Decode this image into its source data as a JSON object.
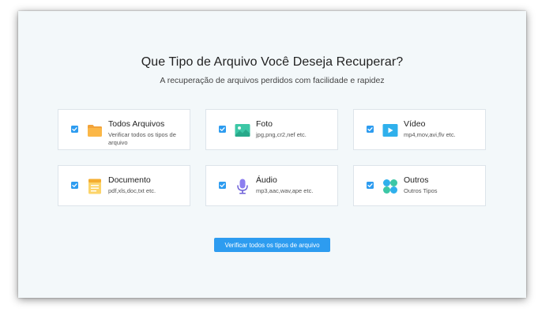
{
  "header": {
    "title": "Que Tipo de Arquivo Você Deseja Recuperar?",
    "subtitle": "A recuperação de arquivos perdidos com facilidade e rapidez"
  },
  "file_types": [
    {
      "label": "Todos Arquivos",
      "description": "Verificar todos os tipos de arquivo",
      "checked": true,
      "icon": "folder-icon"
    },
    {
      "label": "Foto",
      "description": "jpg,png,cr2,nef etc.",
      "checked": true,
      "icon": "image-icon"
    },
    {
      "label": "Vídeo",
      "description": "mp4,mov,avi,flv etc.",
      "checked": true,
      "icon": "video-play-icon"
    },
    {
      "label": "Documento",
      "description": "pdf,xls,doc,txt etc.",
      "checked": true,
      "icon": "document-icon"
    },
    {
      "label": "Áudio",
      "description": "mp3,aac,wav,ape etc.",
      "checked": true,
      "icon": "microphone-icon"
    },
    {
      "label": "Outros",
      "description": "Outros Tipos",
      "checked": true,
      "icon": "other-files-icon"
    }
  ],
  "actions": {
    "scan_label": "Verificar todos os tipos de arquivo"
  },
  "colors": {
    "accent": "#2d9cf0",
    "background": "#f3f8fa",
    "card": "#ffffff"
  }
}
